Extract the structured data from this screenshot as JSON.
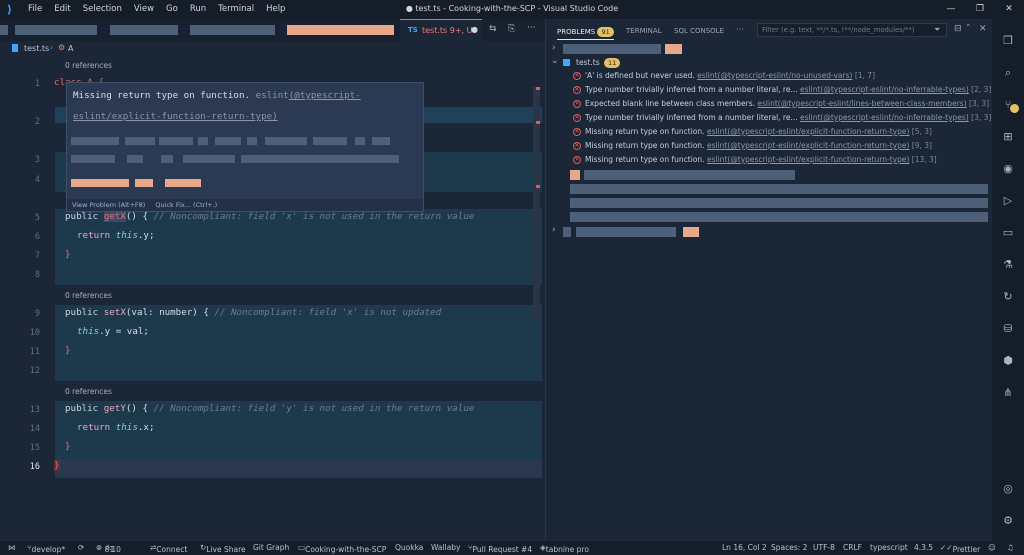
{
  "menu": [
    "File",
    "Edit",
    "Selection",
    "View",
    "Go",
    "Run",
    "Terminal",
    "Help"
  ],
  "window_title": "● test.ts - Cooking-with-the-SCP - Visual Studio Code",
  "tab": {
    "label": "test.ts 9+, U"
  },
  "breadcrumb": {
    "file": "test.ts",
    "symbol": "A"
  },
  "editor": {
    "refs_top": "0 references",
    "refs_set": "0 references",
    "refs_get": "0 references",
    "line_numbers": [
      "1",
      "2",
      "3",
      "4",
      "5",
      "6",
      "7",
      "8",
      "9",
      "10",
      "11",
      "12",
      "13",
      "14",
      "15",
      "16"
    ],
    "code": {
      "l1": "class A {",
      "l5_kw": "public ",
      "l5_fn": "getX",
      "l5_rest": "() {",
      "l5_cm": "// Noncompliant: field 'x' is not used in the return value",
      "l6_kw": "return ",
      "l6_this": "this",
      "l6_rest": ".y;",
      "l7": "}",
      "l9_kw": "public ",
      "l9_fn": "setX",
      "l9_rest": "(val: number) {",
      "l9_cm": "// Noncompliant: field 'x' is not updated",
      "l10_this": "this",
      "l10_rest": ".y = val;",
      "l11": "}",
      "l13_kw": "public ",
      "l13_fn": "getY",
      "l13_rest": "() {",
      "l13_cm": "// Noncompliant: field 'y' is not used in the return value",
      "l14_kw": "return ",
      "l14_this": "this",
      "l14_rest": ".x;",
      "l15": "}",
      "l16": "}"
    }
  },
  "hover": {
    "message": "Missing return type on function.",
    "source": "eslint",
    "rule": "(@typescript-eslint/explicit-function-return-type)",
    "view_problem": "View Problem (Alt+F8)",
    "quick_fix": "Quick Fix... (Ctrl+.)"
  },
  "panel": {
    "tabs": {
      "problems": "PROBLEMS",
      "problems_count": "91",
      "terminal": "TERMINAL",
      "sql": "SQL CONSOLE",
      "more": "···"
    },
    "filter_placeholder": "Filter (e.g. text, **/*.ts, !**/node_modules/**)",
    "file": {
      "name": "test.ts",
      "count": "11"
    },
    "problems": [
      {
        "msg": "'A' is defined but never used.",
        "src": "eslint(@typescript-eslint/no-unused-vars)",
        "loc": "[1, 7]"
      },
      {
        "msg": "Type number trivially inferred from a number literal, re...",
        "src": "eslint(@typescript-eslint/no-inferrable-types)",
        "loc": "[2, 3]"
      },
      {
        "msg": "Expected blank line between class members.",
        "src": "eslint(@typescript-eslint/lines-between-class-members)",
        "loc": "[3, 3]"
      },
      {
        "msg": "Type number trivially inferred from a number literal, re...",
        "src": "eslint(@typescript-eslint/no-inferrable-types)",
        "loc": "[3, 3]"
      },
      {
        "msg": "Missing return type on function.",
        "src": "eslint(@typescript-eslint/explicit-function-return-type)",
        "loc": "[5, 3]"
      },
      {
        "msg": "Missing return type on function.",
        "src": "eslint(@typescript-eslint/explicit-function-return-type)",
        "loc": "[9, 3]"
      },
      {
        "msg": "Missing return type on function.",
        "src": "eslint(@typescript-eslint/explicit-function-return-type)",
        "loc": "[13, 3]"
      }
    ]
  },
  "status": {
    "branch": "develop*",
    "errors": "81",
    "warnings": "10",
    "connect": "Connect",
    "liveshare": "Live Share",
    "gitgraph": "Git Graph",
    "workspace": "Cooking-with-the-SCP",
    "quokka": "Quokka",
    "wallaby": "Wallaby",
    "pr": "Pull Request #4",
    "tabnine": "tabnine pro",
    "position": "Ln 16, Col 2",
    "spaces": "Spaces: 2",
    "encoding": "UTF-8",
    "eol": "CRLF",
    "language": "typescript",
    "version": "4.3.5",
    "prettier": "Prettier"
  }
}
